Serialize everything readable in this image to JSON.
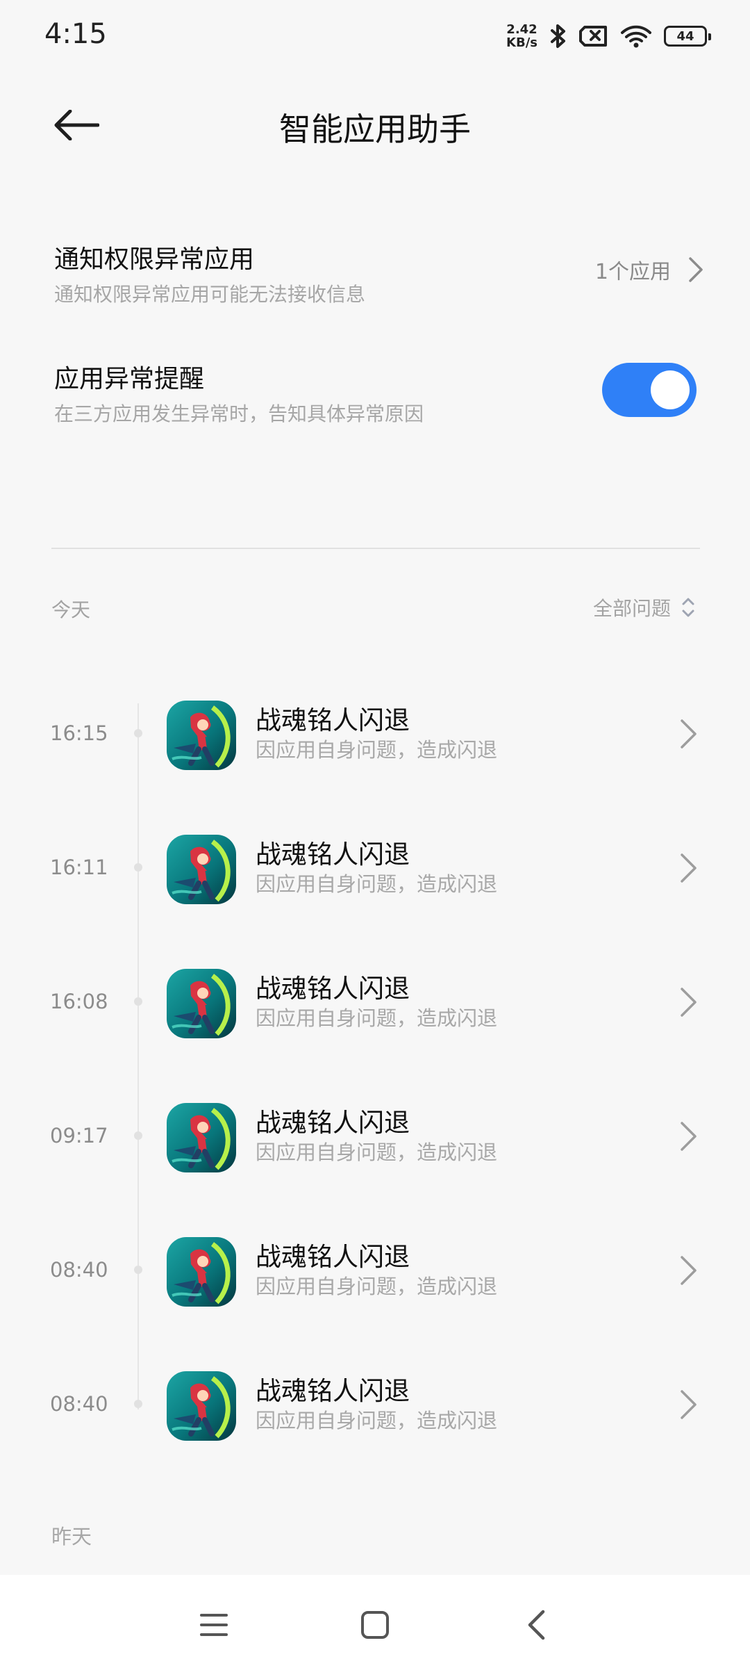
{
  "status_bar": {
    "time": "4:15",
    "network_speed": {
      "value": "2.42",
      "unit": "KB/s"
    },
    "icons": [
      "bluetooth-icon",
      "sim-disabled-icon",
      "wifi-icon",
      "battery-icon"
    ],
    "battery": "44"
  },
  "header": {
    "title": "智能应用助手",
    "back_icon": "arrow-left-icon"
  },
  "settings": {
    "notification_abnormal": {
      "title": "通知权限异常应用",
      "subtitle": "通知权限异常应用可能无法接收信息",
      "value": "1个应用"
    },
    "app_exception_alert": {
      "title": "应用异常提醒",
      "subtitle": "在三方应用发生异常时，告知具体异常原因",
      "enabled": true
    }
  },
  "history": {
    "today_label": "今天",
    "filter_label": "全部问题",
    "records": [
      {
        "time": "16:15",
        "title": "战魂铭人闪退",
        "subtitle": "因应用自身问题，造成闪退"
      },
      {
        "time": "16:11",
        "title": "战魂铭人闪退",
        "subtitle": "因应用自身问题，造成闪退"
      },
      {
        "time": "16:08",
        "title": "战魂铭人闪退",
        "subtitle": "因应用自身问题，造成闪退"
      },
      {
        "time": "09:17",
        "title": "战魂铭人闪退",
        "subtitle": "因应用自身问题，造成闪退"
      },
      {
        "time": "08:40",
        "title": "战魂铭人闪退",
        "subtitle": "因应用自身问题，造成闪退"
      },
      {
        "time": "08:40",
        "title": "战魂铭人闪退",
        "subtitle": "因应用自身问题，造成闪退"
      }
    ],
    "yesterday_label": "昨天"
  },
  "navigation": {
    "items": [
      "menu-icon",
      "home-icon",
      "back-icon"
    ]
  },
  "colors": {
    "background": "#f7f7f7",
    "accent": "#2f80f7",
    "secondary_text": "#a6a6a6"
  }
}
